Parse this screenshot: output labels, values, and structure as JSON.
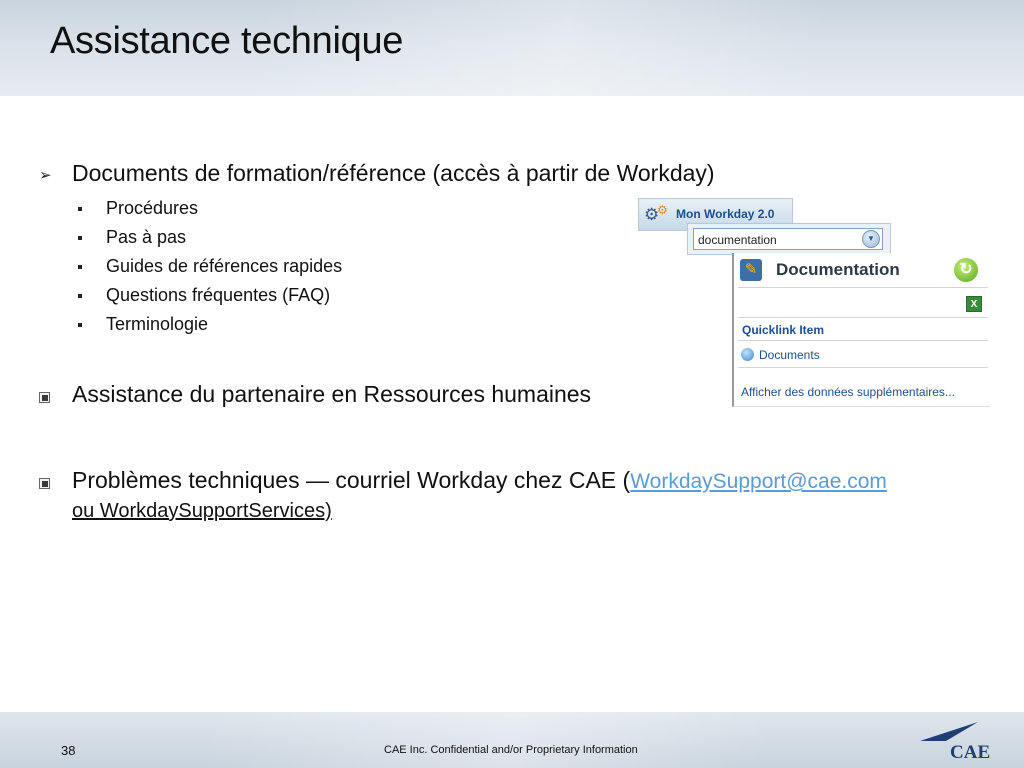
{
  "slide": {
    "title": "Assistance technique",
    "page_number": "38",
    "footer_text": "CAE Inc. Confidential and/or Proprietary Information"
  },
  "bullets": {
    "documents": "Documents de formation/référence (accès à partir de Workday)",
    "sub_items": [
      "Procédures",
      "Pas à pas",
      "Guides de références rapides",
      "Questions fréquentes (FAQ)",
      "Terminologie"
    ],
    "hr_partner": "Assistance du partenaire en Ressources humaines",
    "tech_prefix": "Problèmes techniques — courriel Workday chez CAE (",
    "tech_email": "WorkdaySupport@cae.com",
    "tech_line2": "ou WorkdaySupportServices)"
  },
  "workday_screenshot": {
    "app_title": "Mon Workday 2.0",
    "search_value": "documentation",
    "panel_title": "Documentation",
    "quicklink_header": "Quicklink Item",
    "quicklink_item": "Documents",
    "more_link": "Afficher des données supplémentaires..."
  },
  "logo": {
    "text": "CAE",
    "color": "#1f3f73"
  }
}
